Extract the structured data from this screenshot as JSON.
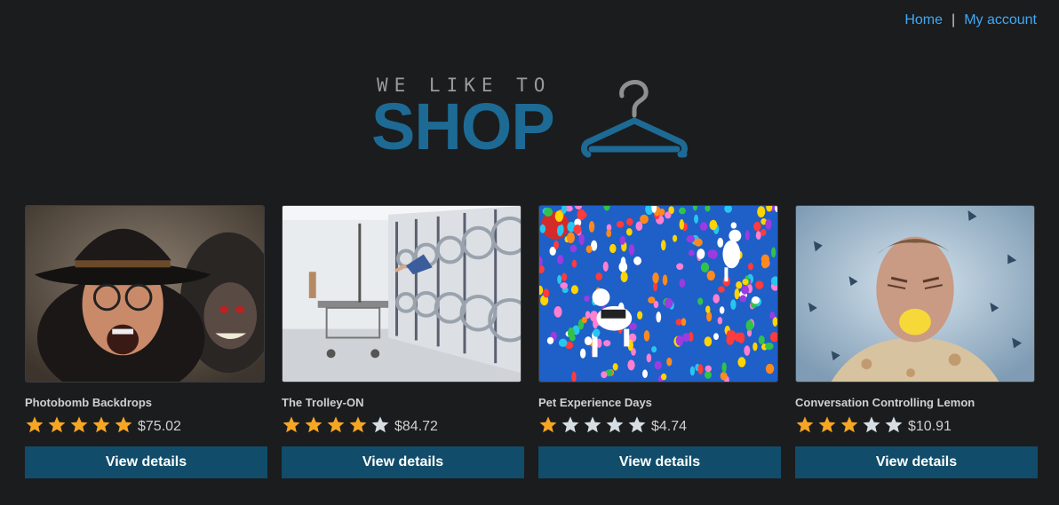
{
  "nav": {
    "home_label": "Home",
    "separator": "|",
    "account_label": "My account"
  },
  "logo": {
    "tagline": "WE LIKE TO",
    "wordmark": "SHOP",
    "icon": "hanger-icon",
    "color": "#1d6a95"
  },
  "colors": {
    "background": "#1b1c1e",
    "link": "#3fa9f5",
    "button": "#114d6a",
    "star_filled": "#f6a623",
    "star_empty": "#d6dde3"
  },
  "products": [
    {
      "name": "Photobomb Backdrops",
      "rating": 5,
      "price": "$75.02",
      "button_label": "View details",
      "image": "old-man-with-monkey-photo"
    },
    {
      "name": "The Trolley-ON",
      "rating": 4,
      "price": "$84.72",
      "button_label": "View details",
      "image": "laundromat-photo"
    },
    {
      "name": "Pet Experience Days",
      "rating": 1,
      "price": "$4.74",
      "button_label": "View details",
      "image": "dogs-with-balloons-photo"
    },
    {
      "name": "Conversation Controlling Lemon",
      "rating": 3,
      "price": "$10.91",
      "button_label": "View details",
      "image": "man-with-lemon-photo"
    }
  ]
}
